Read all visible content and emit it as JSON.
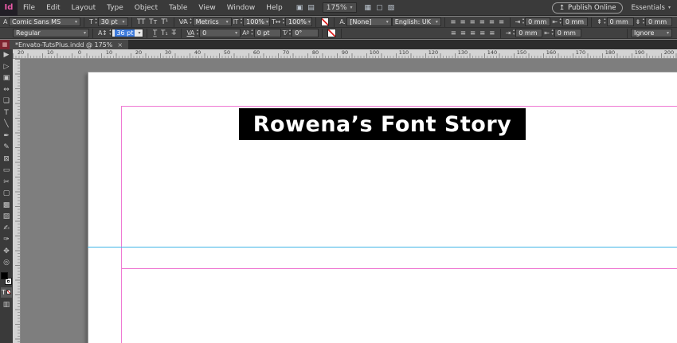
{
  "icons": {
    "caret": "▾",
    "spin_up": "▴",
    "spin_down": "▾"
  },
  "menubar": {
    "logo": "Id",
    "menus": [
      "File",
      "Edit",
      "Layout",
      "Type",
      "Object",
      "Table",
      "View",
      "Window",
      "Help"
    ],
    "app_icons": [
      {
        "name": "preview-mode-icon",
        "glyph": "▣"
      },
      {
        "name": "gpu-performance-icon",
        "glyph": "▤"
      }
    ],
    "zoom": "175%",
    "view_icons": [
      {
        "name": "view-options-icon",
        "glyph": "▦"
      },
      {
        "name": "screen-mode-icon",
        "glyph": "▢"
      },
      {
        "name": "arrange-documents-icon",
        "glyph": "▧"
      }
    ],
    "publish_icon": "↥",
    "publish": "Publish Online",
    "workspace": "Essentials"
  },
  "control_panel": {
    "row1": {
      "formatting_icon": "A",
      "font_family": "Comic Sans MS",
      "size_icon": "T",
      "font_size": "30 pt",
      "case_icons": [
        {
          "name": "all-caps-icon",
          "glyph": "TT"
        },
        {
          "name": "small-caps-icon",
          "glyph": "Tᴛ"
        },
        {
          "name": "superscript-icon",
          "glyph": "T¹"
        }
      ],
      "kerning_icon": "V⁄A",
      "kerning": "Metrics",
      "vscale_icon": "IT",
      "vertical_scale": "100%",
      "hscale_icon": "T↔",
      "horizontal_scale": "100%",
      "char_style_icon": "A.",
      "char_style": "[None]",
      "language": "English: UK",
      "align_icons": [
        {
          "name": "align-left-icon",
          "glyph": "≡"
        },
        {
          "name": "align-center-icon",
          "glyph": "≡"
        },
        {
          "name": "align-right-icon",
          "glyph": "≡"
        },
        {
          "name": "justify-left-icon",
          "glyph": "≡"
        },
        {
          "name": "justify-center-icon",
          "glyph": "≡"
        },
        {
          "name": "justify-right-icon",
          "glyph": "≡"
        }
      ],
      "indent_left_icon": "⇥",
      "indent_left": "0 mm",
      "indent_right_icon": "⇤",
      "indent_right": "0 mm",
      "space_before_icon": "⇞",
      "space_before": "0 mm",
      "space_after_icon": "⇟",
      "space_after": "0 mm"
    },
    "row2": {
      "font_style": "Regular",
      "leading_icon": "A↕",
      "leading": "36 pt",
      "decoration_icons": [
        {
          "name": "underline-icon",
          "glyph": "T̲"
        },
        {
          "name": "subscript-icon",
          "glyph": "T₁"
        },
        {
          "name": "strikethrough-icon",
          "glyph": "T̶"
        }
      ],
      "tracking_icon": "VA",
      "tracking": "0",
      "baseline_icon": "Aª",
      "baseline_shift": "0 pt",
      "skew_icon": "T⁄",
      "skew": "0°",
      "align_icons": [
        {
          "name": "justify-all-icon",
          "glyph": "≡"
        },
        {
          "name": "align-towards-spine-icon",
          "glyph": "≡"
        },
        {
          "name": "align-away-from-spine-icon",
          "glyph": "≡"
        },
        {
          "name": "balance-ragged-lines-icon",
          "glyph": "≡"
        },
        {
          "name": "paragraph-options-icon",
          "glyph": "≡"
        }
      ],
      "indent_first_icon": "⇥",
      "indent_first": "0 mm",
      "indent_last_icon": "⇤",
      "indent_last": "0 mm",
      "vertical_justification": "Ignore"
    }
  },
  "tab": {
    "title": "*Envato-TutsPlus.indd @ 175%",
    "close": "×"
  },
  "ruler": {
    "labels": [
      "20",
      "10",
      "0",
      "10",
      "20",
      "30",
      "40",
      "50",
      "60",
      "70",
      "80",
      "90",
      "100",
      "110",
      "120",
      "130",
      "140",
      "150",
      "160",
      "170",
      "180",
      "190",
      "200"
    ]
  },
  "tools": [
    {
      "name": "selection-tool",
      "glyph": "▶"
    },
    {
      "name": "direct-selection-tool",
      "glyph": "▷"
    },
    {
      "name": "page-tool",
      "glyph": "▣"
    },
    {
      "name": "gap-tool",
      "glyph": "⇔"
    },
    {
      "name": "content-collector-tool",
      "glyph": "❏"
    },
    {
      "name": "type-tool",
      "glyph": "T"
    },
    {
      "name": "line-tool",
      "glyph": "╲"
    },
    {
      "name": "pen-tool",
      "glyph": "✒"
    },
    {
      "name": "pencil-tool",
      "glyph": "✎"
    },
    {
      "name": "rectangle-frame-tool",
      "glyph": "⊠"
    },
    {
      "name": "rectangle-tool",
      "glyph": "▭"
    },
    {
      "name": "scissors-tool",
      "glyph": "✂"
    },
    {
      "name": "free-transform-tool",
      "glyph": "▢"
    },
    {
      "name": "gradient-swatch-tool",
      "glyph": "▩"
    },
    {
      "name": "gradient-feather-tool",
      "glyph": "▨"
    },
    {
      "name": "note-tool",
      "glyph": "✍"
    },
    {
      "name": "eyedropper-tool",
      "glyph": "✑"
    },
    {
      "name": "hand-tool",
      "glyph": "✥"
    },
    {
      "name": "zoom-tool",
      "glyph": "◎"
    }
  ],
  "tools_bottom": {
    "apply_text": "T",
    "screen_mode": "▥"
  },
  "page": {
    "title": "Rowena’s Font Story"
  },
  "colors": {
    "margin_guide": "#ef79d3",
    "ruler_guide": "#3fb4e6",
    "selection": "#3e7bdc",
    "accent_pink": "#ea5aa8"
  }
}
